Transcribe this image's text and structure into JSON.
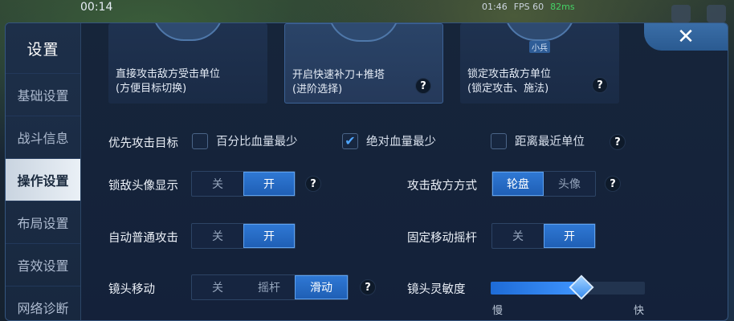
{
  "hud": {
    "time_left": "00:14",
    "time_right": "01:46",
    "fps": "FPS 60",
    "ping": "82ms"
  },
  "sidebar": {
    "title": "设置",
    "items": [
      {
        "label": "基础设置",
        "active": false
      },
      {
        "label": "战斗信息",
        "active": false
      },
      {
        "label": "操作设置",
        "active": true
      },
      {
        "label": "布局设置",
        "active": false
      },
      {
        "label": "音效设置",
        "active": false
      },
      {
        "label": "网络诊断",
        "active": false
      }
    ]
  },
  "close": {
    "glyph": "✕"
  },
  "cards": [
    {
      "line1": "直接攻击敌方受击单位",
      "line2": "(方便目标切换)",
      "selected": false,
      "thumb_label": ""
    },
    {
      "line1": "开启快速补刀+推塔",
      "line2": "(进阶选择)",
      "selected": true,
      "thumb_label": ""
    },
    {
      "line1": "锁定攻击敌方单位",
      "line2": "(锁定攻击、施法)",
      "selected": false,
      "thumb_label": "小兵"
    }
  ],
  "priority": {
    "label": "优先攻击目标",
    "options": [
      {
        "label": "百分比血量最少",
        "checked": false
      },
      {
        "label": "绝对血量最少",
        "checked": true
      },
      {
        "label": "距离最近单位",
        "checked": false
      }
    ]
  },
  "lock_avatar": {
    "label": "锁敌头像显示",
    "off": "关",
    "on": "开",
    "value": "开"
  },
  "attack_mode": {
    "label": "攻击敌方方式",
    "opt1": "轮盘",
    "opt2": "头像",
    "value": "轮盘"
  },
  "auto_attack": {
    "label": "自动普通攻击",
    "off": "关",
    "on": "开",
    "value": "开"
  },
  "fixed_joystick": {
    "label": "固定移动摇杆",
    "off": "关",
    "on": "开",
    "value": "开"
  },
  "camera_move": {
    "label": "镜头移动",
    "opt1": "关",
    "opt2": "摇杆",
    "opt3": "滑动",
    "value": "滑动"
  },
  "camera_sensitivity": {
    "label": "镜头灵敏度",
    "min_label": "慢",
    "max_label": "快",
    "value": 0.59
  },
  "help_glyph": "?"
}
